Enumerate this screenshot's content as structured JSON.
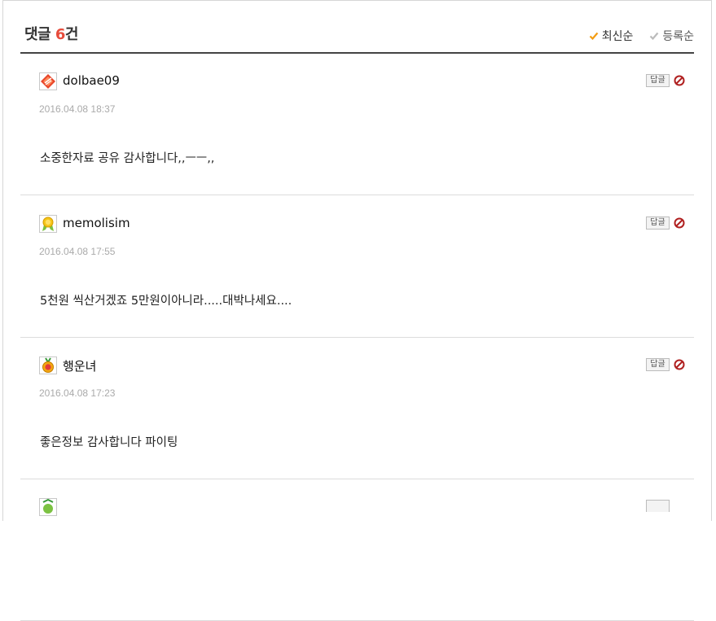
{
  "header": {
    "title_prefix": "댓글 ",
    "count": "6",
    "title_suffix": "건",
    "sort_latest": "최신순",
    "sort_registered": "등록순",
    "sort_active_color": "#f39c12",
    "sort_inactive_color": "#bbbbbb"
  },
  "comments": [
    {
      "nickname": "dolbae09",
      "date": "2016.04.08 18:37",
      "text": "소중한자료 공유 감사합니다,,ㅡㅡ,,",
      "reply_label": "답글",
      "avatar_icon": "red-diamond-badge-icon"
    },
    {
      "nickname": "memolisim",
      "date": "2016.04.08 17:55",
      "text": "5천원 씩산거겠죠 5만원이아니라.....대박나세요....",
      "reply_label": "답글",
      "avatar_icon": "gold-ribbon-badge-icon"
    },
    {
      "nickname": "행운녀",
      "date": "2016.04.08 17:23",
      "text": "좋은정보 감사합니다 파이팅",
      "reply_label": "답글",
      "avatar_icon": "gold-medal-badge-icon"
    },
    {
      "nickname": "",
      "date": "",
      "text": "",
      "reply_label": "",
      "avatar_icon": "green-badge-icon"
    }
  ]
}
